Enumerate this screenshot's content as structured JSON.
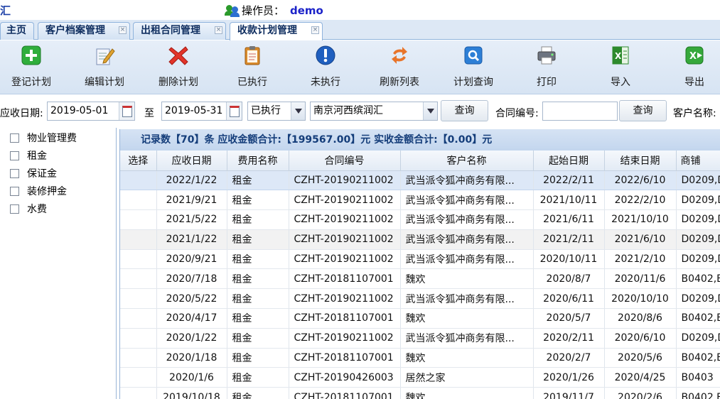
{
  "header": {
    "app_title": "汇",
    "operator_label": "操作员：",
    "operator_name": "demo"
  },
  "tabs": [
    {
      "label": "主页"
    },
    {
      "label": "客户档案管理"
    },
    {
      "label": "出租合同管理"
    },
    {
      "label": "收款计划管理"
    }
  ],
  "toolbar": {
    "register": "登记计划",
    "edit": "编辑计划",
    "delete": "删除计划",
    "executed": "已执行",
    "not_executed": "未执行",
    "refresh": "刷新列表",
    "query": "计划查询",
    "print": "打印",
    "import": "导入",
    "export": "导出"
  },
  "filter": {
    "date_label": "应收日期:",
    "date_from": "2019-05-01",
    "to_label": "至",
    "date_to": "2019-05-31",
    "status": "已执行",
    "project": "南京河西缤润汇",
    "query_button": "查询",
    "contract_label": "合同编号:",
    "contract_value": "",
    "query_button2": "查询",
    "customer_label": "客户名称:"
  },
  "sidebar": {
    "items": [
      {
        "label": "物业管理费"
      },
      {
        "label": "租金"
      },
      {
        "label": "保证金"
      },
      {
        "label": "装修押金"
      },
      {
        "label": "水费"
      }
    ]
  },
  "summary": {
    "text": "记录数【70】条   应收金额合计:【199567.00】元    实收金额合计:【0.00】元"
  },
  "table": {
    "columns": [
      "选择",
      "应收日期",
      "费用名称",
      "合同编号",
      "客户名称",
      "起始日期",
      "结束日期",
      "商铺"
    ],
    "rows": [
      [
        "",
        "2022/1/22",
        "租金",
        "CZHT-20190211002",
        "武当派令狐冲商务有限...",
        "2022/2/11",
        "2022/6/10",
        "D0209,D"
      ],
      [
        "",
        "2021/9/21",
        "租金",
        "CZHT-20190211002",
        "武当派令狐冲商务有限...",
        "2021/10/11",
        "2022/2/10",
        "D0209,D"
      ],
      [
        "",
        "2021/5/22",
        "租金",
        "CZHT-20190211002",
        "武当派令狐冲商务有限...",
        "2021/6/11",
        "2021/10/10",
        "D0209,D"
      ],
      [
        "",
        "2021/1/22",
        "租金",
        "CZHT-20190211002",
        "武当派令狐冲商务有限...",
        "2021/2/11",
        "2021/6/10",
        "D0209,D"
      ],
      [
        "",
        "2020/9/21",
        "租金",
        "CZHT-20190211002",
        "武当派令狐冲商务有限...",
        "2020/10/11",
        "2021/2/10",
        "D0209,D"
      ],
      [
        "",
        "2020/7/18",
        "租金",
        "CZHT-20181107001",
        "魏欢",
        "2020/8/7",
        "2020/11/6",
        "B0402,B"
      ],
      [
        "",
        "2020/5/22",
        "租金",
        "CZHT-20190211002",
        "武当派令狐冲商务有限...",
        "2020/6/11",
        "2020/10/10",
        "D0209,D"
      ],
      [
        "",
        "2020/4/17",
        "租金",
        "CZHT-20181107001",
        "魏欢",
        "2020/5/7",
        "2020/8/6",
        "B0402,B"
      ],
      [
        "",
        "2020/1/22",
        "租金",
        "CZHT-20190211002",
        "武当派令狐冲商务有限...",
        "2020/2/11",
        "2020/6/10",
        "D0209,D"
      ],
      [
        "",
        "2020/1/18",
        "租金",
        "CZHT-20181107001",
        "魏欢",
        "2020/2/7",
        "2020/5/6",
        "B0402,B"
      ],
      [
        "",
        "2020/1/6",
        "租金",
        "CZHT-20190426003",
        "居然之家",
        "2020/1/26",
        "2020/4/25",
        "B0403"
      ],
      [
        "",
        "2019/10/18",
        "租金",
        "CZHT-20181107001",
        "魏欢",
        "2019/11/7",
        "2020/2/6",
        "B0402,B"
      ]
    ]
  }
}
